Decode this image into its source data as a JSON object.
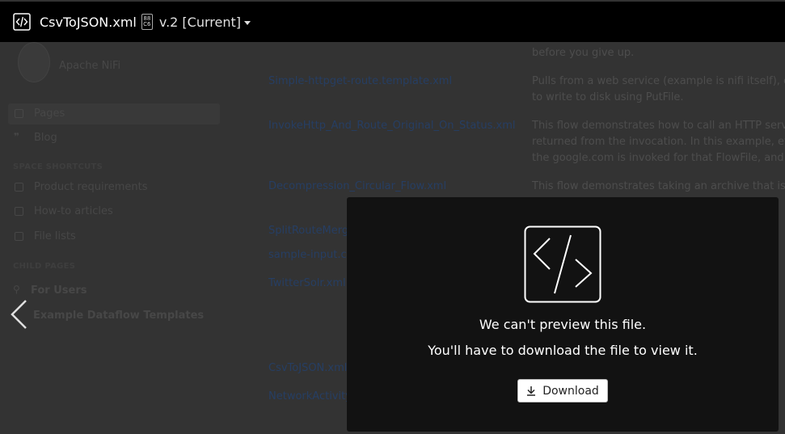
{
  "header": {
    "file_name": "CsvToJSON.xml",
    "mini_icon_text": "88\nC6",
    "version_label": "v.2 [Current]"
  },
  "background": {
    "sidebar": {
      "space_name": "Apache NiFi",
      "nav": [
        {
          "label": "Pages",
          "icon": "page-icon"
        },
        {
          "label": "Blog",
          "icon": "quote-icon"
        }
      ],
      "shortcuts_heading": "SPACE SHORTCUTS",
      "shortcuts": [
        {
          "label": "Product requirements",
          "icon": "link-icon"
        },
        {
          "label": "How-to articles",
          "icon": "link-icon"
        },
        {
          "label": "File lists",
          "icon": "link-icon"
        }
      ],
      "child_heading": "CHILD PAGES",
      "children": [
        {
          "label": "For Users"
        },
        {
          "label": "Example Dataflow Templates"
        }
      ]
    },
    "files": [
      "Simple-httpget-route.template.xml",
      "InvokeHttp_And_Route_Original_On_Status.xml",
      "Decompression_Circular_Flow.xml",
      "SplitRouteMerge.xml",
      "sample-input.csv",
      "TwitterSolr.xml",
      "CsvToJSON.xml",
      "NetworkActivity"
    ],
    "descriptions": [
      "before you give up.",
      "Pulls from a web service (example is nifi itself), ex",
      "to write to disk using PutFile.",
      "This flow demonstrates how to call an HTTP servi",
      "returned from the invocation. In this example, eve",
      "the google.com is invoked for that FlowFile, and a",
      "This flow demonstrates taking an archive that is c"
    ]
  },
  "preview": {
    "message_title": "We can't preview this file.",
    "message_body": "You'll have to download the file to view it.",
    "download_label": "Download"
  }
}
